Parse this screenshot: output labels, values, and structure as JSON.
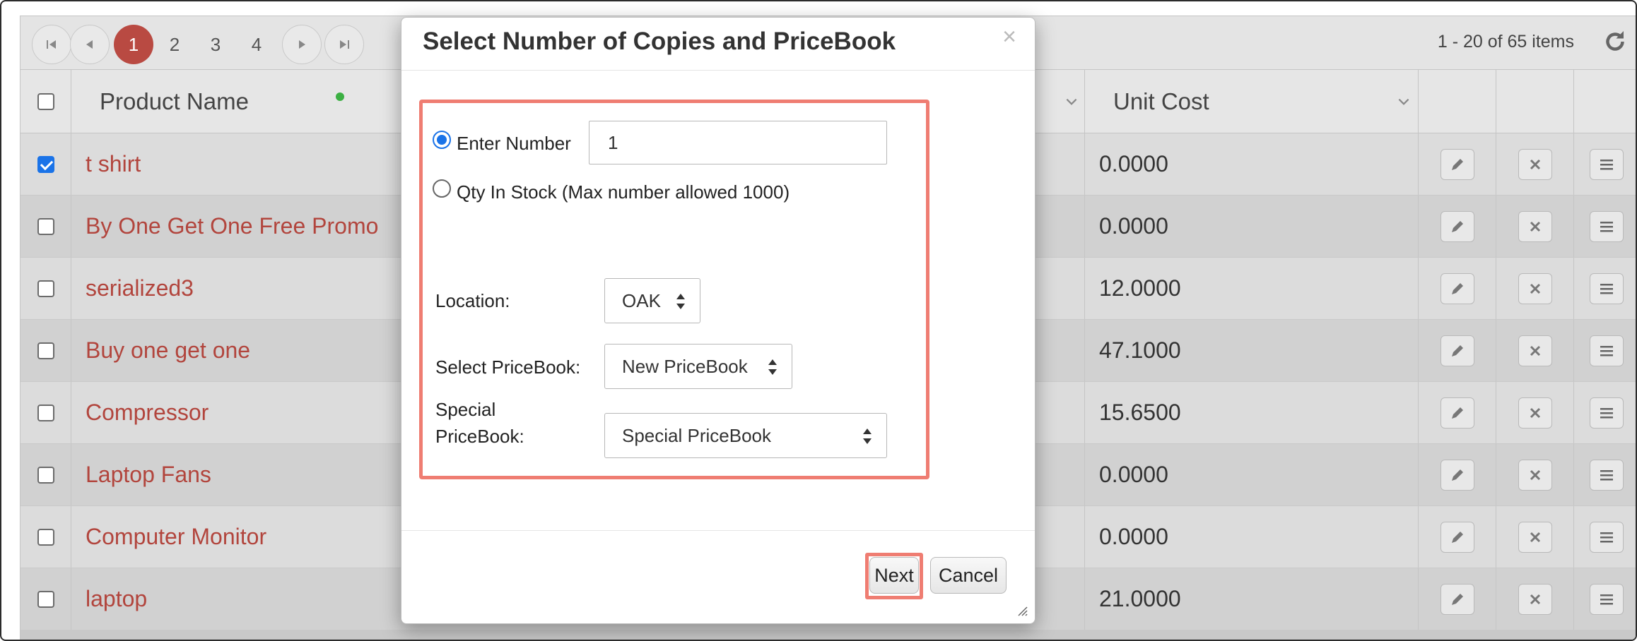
{
  "pager": {
    "pages": [
      "1",
      "2",
      "3",
      "4"
    ],
    "active_page": "1",
    "info": "1 - 20 of 65 items"
  },
  "table": {
    "headers": {
      "product_name": "Product Name",
      "unit_cost": "Unit Cost"
    },
    "rows": [
      {
        "name": "t shirt",
        "cost": "0.0000",
        "checked": true
      },
      {
        "name": "By One Get One Free Promo",
        "cost": "0.0000",
        "checked": false
      },
      {
        "name": "serialized3",
        "cost": "12.0000",
        "checked": false
      },
      {
        "name": "Buy one get one",
        "cost": "47.1000",
        "checked": false
      },
      {
        "name": "Compressor",
        "cost": "15.6500",
        "checked": false
      },
      {
        "name": "Laptop Fans",
        "cost": "0.0000",
        "checked": false
      },
      {
        "name": "Computer Monitor",
        "cost": "0.0000",
        "checked": false
      },
      {
        "name": "laptop",
        "cost": "21.0000",
        "checked": false
      }
    ]
  },
  "modal": {
    "title": "Select Number of Copies and PriceBook",
    "close_glyph": "×",
    "enter_number_label": "Enter Number",
    "enter_number_value": "1",
    "qty_in_stock_label": "Qty In Stock (Max number allowed 1000)",
    "location_label": "Location:",
    "location_value": "OAK",
    "pricebook_label": "Select PriceBook:",
    "pricebook_value": "New PriceBook",
    "special_label_line1": "Special",
    "special_label_line2": "PriceBook:",
    "special_value": "Special PriceBook",
    "next_label": "Next",
    "cancel_label": "Cancel"
  },
  "colors": {
    "accent_red": "#b94a42",
    "highlight": "#ef7d72",
    "link": "#b2453d"
  }
}
